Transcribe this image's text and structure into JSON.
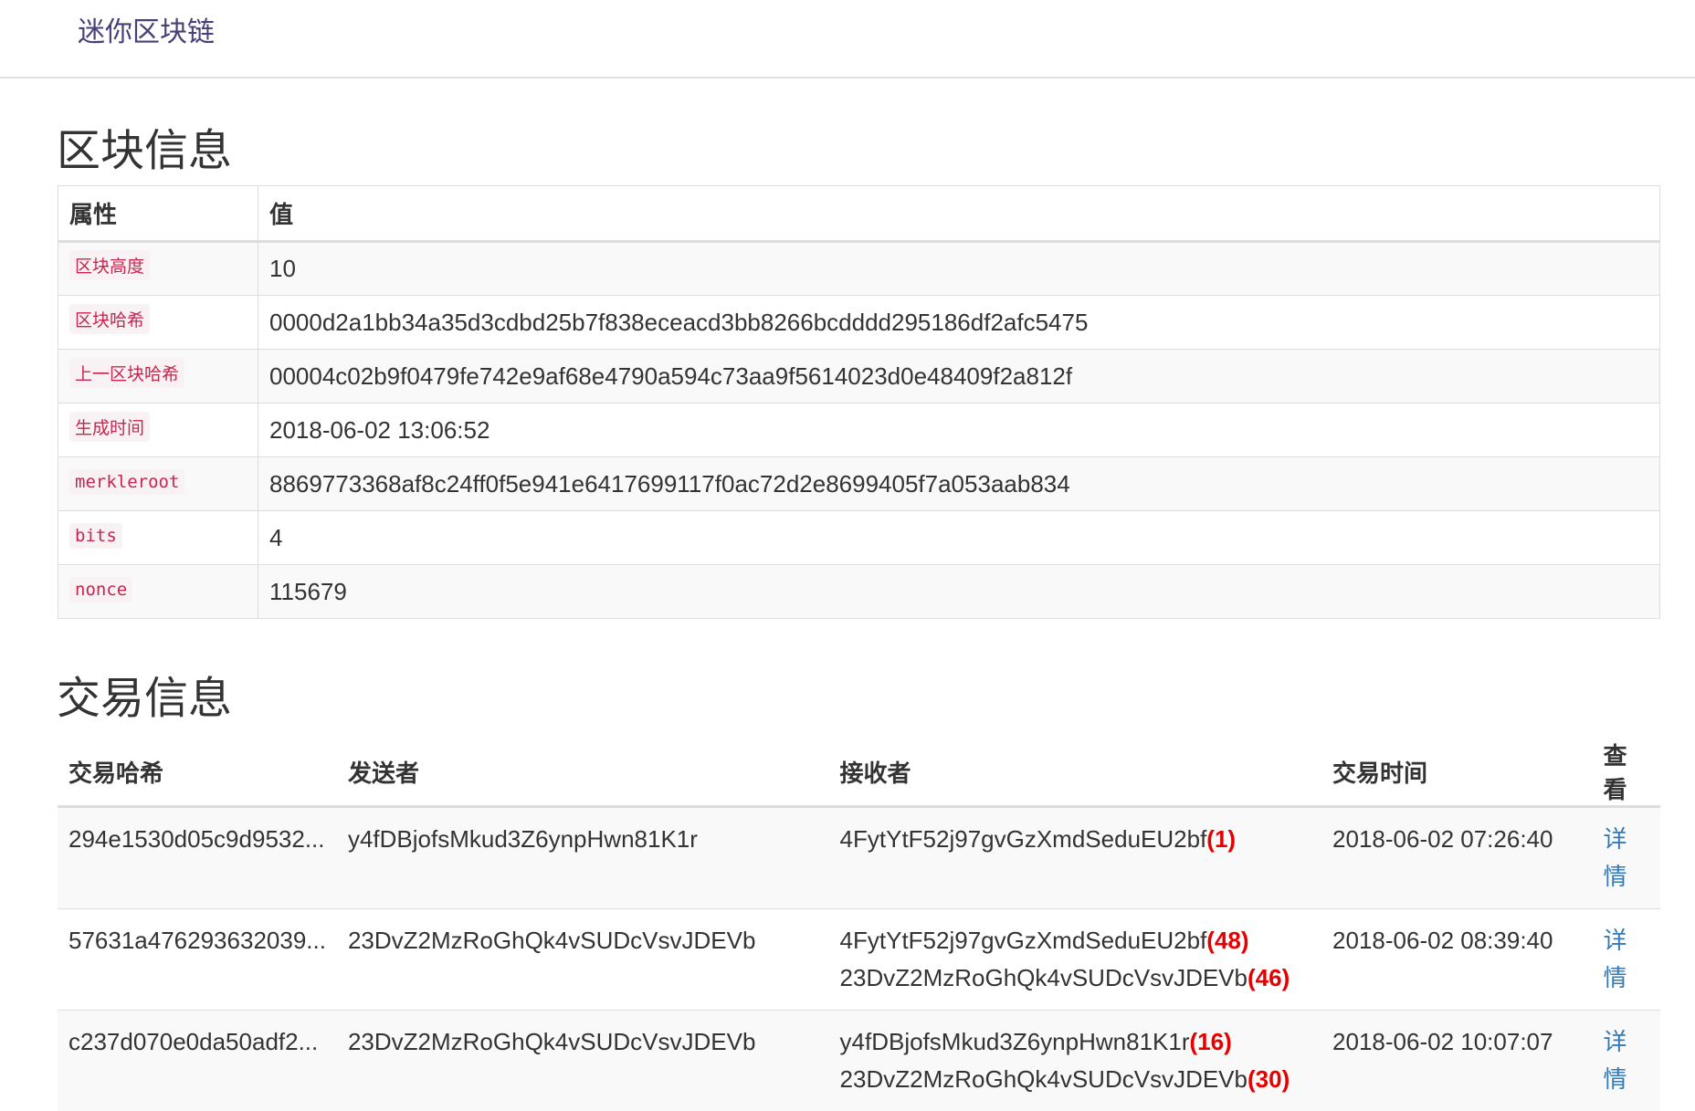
{
  "navbar": {
    "brand": "迷你区块链"
  },
  "block_section": {
    "title": "区块信息",
    "headers": {
      "attr": "属性",
      "value": "值"
    },
    "rows": [
      {
        "key": "区块高度",
        "value": "10"
      },
      {
        "key": "区块哈希",
        "value": "0000d2a1bb34a35d3cdbd25b7f838eceacd3bb8266bcdddd295186df2afc5475"
      },
      {
        "key": "上一区块哈希",
        "value": "00004c02b9f0479fe742e9af68e4790a594c73aa9f5614023d0e48409f2a812f"
      },
      {
        "key": "生成时间",
        "value": "2018-06-02 13:06:52"
      },
      {
        "key": "merkleroot",
        "value": "8869773368af8c24ff0f5e941e6417699117f0ac72d2e8699405f7a053aab834"
      },
      {
        "key": "bits",
        "value": "4"
      },
      {
        "key": "nonce",
        "value": "115679"
      }
    ]
  },
  "tx_section": {
    "title": "交易信息",
    "headers": {
      "hash": "交易哈希",
      "sender": "发送者",
      "receiver": "接收者",
      "time": "交易时间",
      "view": "查看"
    },
    "rows": [
      {
        "hash": "294e1530d05c9d9532...",
        "sender": "y4fDBjofsMkud3Z6ynpHwn81K1r",
        "receiver_1": "4FytYtF52j97gvGzXmdSeduEU2bf",
        "receiver_1_amount": "(1)",
        "receiver_2": "",
        "receiver_2_amount": "",
        "time": "2018-06-02 07:26:40",
        "link": "详情"
      },
      {
        "hash": "57631a476293632039...",
        "sender": "23DvZ2MzRoGhQk4vSUDcVsvJDEVb",
        "receiver_1": "4FytYtF52j97gvGzXmdSeduEU2bf",
        "receiver_1_amount": "(48)",
        "receiver_2": "23DvZ2MzRoGhQk4vSUDcVsvJDEVb",
        "receiver_2_amount": "(46)",
        "time": "2018-06-02 08:39:40",
        "link": "详情"
      },
      {
        "hash": "c237d070e0da50adf2...",
        "sender": "23DvZ2MzRoGhQk4vSUDcVsvJDEVb",
        "receiver_1": "y4fDBjofsMkud3Z6ynpHwn81K1r",
        "receiver_1_amount": "(16)",
        "receiver_2": "23DvZ2MzRoGhQk4vSUDcVsvJDEVb",
        "receiver_2_amount": "(30)",
        "time": "2018-06-02 10:07:07",
        "link": "详情"
      }
    ]
  },
  "colors": {
    "brand": "#4b3f78",
    "code_text": "#c7254e",
    "code_bg": "#f9f2f4",
    "amount": "#e60000",
    "link": "#337ab7"
  }
}
